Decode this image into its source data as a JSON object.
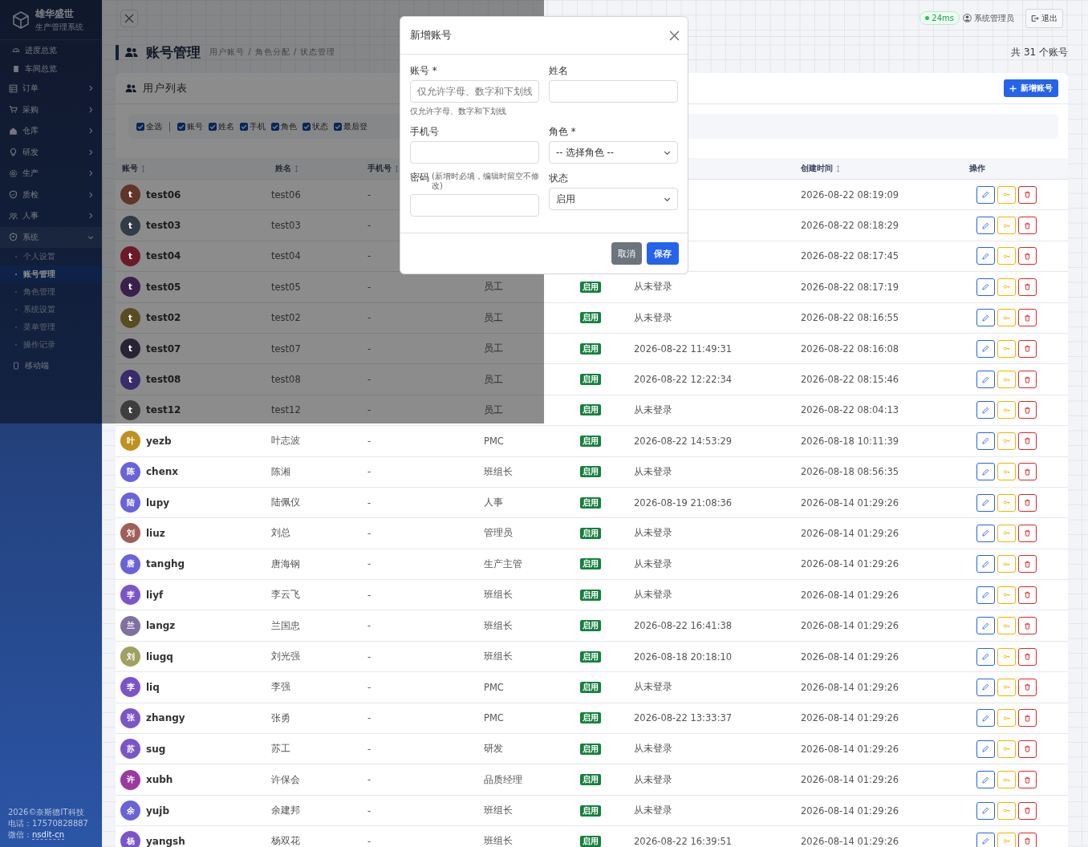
{
  "sidebar": {
    "brand": {
      "title": "雄华盛世",
      "subtitle": "生产管理系统"
    },
    "items": [
      {
        "label": "进度总览",
        "kind": "link",
        "selected": false
      },
      {
        "label": "车间总览",
        "kind": "link",
        "selected": false
      },
      {
        "label": "订单",
        "kind": "group",
        "expanded": false
      },
      {
        "label": "采购",
        "kind": "group",
        "expanded": false
      },
      {
        "label": "仓库",
        "kind": "group",
        "expanded": false
      },
      {
        "label": "研发",
        "kind": "group",
        "expanded": false
      },
      {
        "label": "生产",
        "kind": "group",
        "expanded": false
      },
      {
        "label": "质检",
        "kind": "group",
        "expanded": false
      },
      {
        "label": "人事",
        "kind": "group",
        "expanded": false
      },
      {
        "label": "系统",
        "kind": "group",
        "expanded": true,
        "children": [
          {
            "label": "个人设置",
            "selected": false
          },
          {
            "label": "账号管理",
            "selected": true
          },
          {
            "label": "角色管理",
            "selected": false
          },
          {
            "label": "系统设置",
            "selected": false
          },
          {
            "label": "菜单管理",
            "selected": false
          },
          {
            "label": "操作记录",
            "selected": false
          }
        ]
      },
      {
        "label": "移动端",
        "kind": "link",
        "selected": false
      }
    ],
    "footer": {
      "copyright": "2026©奈斯德IT科技",
      "phone": "电话：17570828887",
      "wechat_label": "微信：",
      "wechat": "nsdit-cn"
    }
  },
  "header": {
    "ping": "24ms",
    "user": "系统管理员",
    "logout": "退出"
  },
  "page": {
    "title": "账号管理",
    "subtitle": "用户账号 / 角色分配 / 状态管理",
    "count": "共 31 个账号"
  },
  "card": {
    "title": "用户列表",
    "add_button": "新增账号",
    "filters": [
      {
        "label": "全选",
        "checked": true,
        "kind": "all"
      },
      {
        "label": "账号",
        "checked": true,
        "kind": "column"
      },
      {
        "label": "姓名",
        "checked": true,
        "kind": "column"
      },
      {
        "label": "手机",
        "checked": true,
        "kind": "column"
      },
      {
        "label": "角色",
        "checked": true,
        "kind": "column"
      },
      {
        "label": "状态",
        "checked": true,
        "kind": "column"
      },
      {
        "label": "最后登",
        "checked": true,
        "kind": "column"
      }
    ]
  },
  "table": {
    "columns": [
      {
        "kind": "account",
        "label": "账号",
        "sortable": true
      },
      {
        "kind": "name",
        "label": "姓名",
        "sortable": true
      },
      {
        "kind": "phone",
        "label": "手机号",
        "sortable": true
      },
      {
        "kind": "created",
        "label": "创建时间",
        "sortable": true
      },
      {
        "kind": "actions",
        "label": "操作",
        "sortable": false
      }
    ],
    "rows": [
      {
        "initial": "t",
        "color": "#613529",
        "account": "test06",
        "name": "test06",
        "phone": "-",
        "created": "2026-08-22 08:19:09"
      },
      {
        "initial": "t",
        "color": "#323b46",
        "account": "test03",
        "name": "test03",
        "phone": "-",
        "created": "2026-08-22 08:18:29"
      },
      {
        "initial": "t",
        "color": "#6a1a29",
        "account": "test04",
        "name": "test04",
        "phone": "-",
        "created": "2026-08-22 08:17:45"
      },
      {
        "initial": "t",
        "color": "#3a204c",
        "account": "test05",
        "name": "test05",
        "phone": "-",
        "role": "员工",
        "status": "启用",
        "last_login": "从未登录",
        "created": "2026-08-22 08:17:19"
      },
      {
        "initial": "t",
        "color": "#584c23",
        "account": "test02",
        "name": "test02",
        "phone": "-",
        "role": "员工",
        "status": "启用",
        "last_login": "从未登录",
        "created": "2026-08-22 08:16:55"
      },
      {
        "initial": "t",
        "color": "#292335",
        "account": "test07",
        "name": "test07",
        "phone": "-",
        "role": "员工",
        "status": "启用",
        "last_login": "2026-08-22 11:49:31",
        "created": "2026-08-22 08:16:08"
      },
      {
        "initial": "t",
        "color": "#3a2c6a",
        "account": "test08",
        "name": "test08",
        "phone": "-",
        "role": "员工",
        "status": "启用",
        "last_login": "2026-08-22 12:22:34",
        "created": "2026-08-22 08:15:46"
      },
      {
        "initial": "t",
        "color": "#3e3e3e",
        "account": "test12",
        "name": "test12",
        "phone": "-",
        "role": "员工",
        "status": "启用",
        "last_login": "从未登录",
        "created": "2026-08-22 08:04:13"
      },
      {
        "initial": "叶",
        "color": "#c09020",
        "account": "yezb",
        "name": "叶志波",
        "phone": "-",
        "role": "PMC",
        "status": "启用",
        "last_login": "2026-08-22 14:53:29",
        "created": "2026-08-18 10:11:39"
      },
      {
        "initial": "陈",
        "color": "#6a62d8",
        "account": "chenx",
        "name": "陈湘",
        "phone": "-",
        "role": "班组长",
        "status": "启用",
        "last_login": "从未登录",
        "created": "2026-08-18 08:56:35"
      },
      {
        "initial": "陆",
        "color": "#6a62d8",
        "account": "lupy",
        "name": "陆佩仪",
        "phone": "-",
        "role": "人事",
        "status": "启用",
        "last_login": "2026-08-19 21:08:36",
        "created": "2026-08-14 01:29:26"
      },
      {
        "initial": "刘",
        "color": "#a0605a",
        "account": "liuz",
        "name": "刘总",
        "phone": "-",
        "role": "管理员",
        "status": "启用",
        "last_login": "从未登录",
        "created": "2026-08-14 01:29:26"
      },
      {
        "initial": "唐",
        "color": "#6a62d8",
        "account": "tanghg",
        "name": "唐海钢",
        "phone": "-",
        "role": "生产主管",
        "status": "启用",
        "last_login": "从未登录",
        "created": "2026-08-14 01:29:26"
      },
      {
        "initial": "李",
        "color": "#7a55c8",
        "account": "liyf",
        "name": "李云飞",
        "phone": "-",
        "role": "班组长",
        "status": "启用",
        "last_login": "从未登录",
        "created": "2026-08-14 01:29:26"
      },
      {
        "initial": "兰",
        "color": "#8070a0",
        "account": "langz",
        "name": "兰国忠",
        "phone": "-",
        "role": "班组长",
        "status": "启用",
        "last_login": "2026-08-22 16:41:38",
        "created": "2026-08-14 01:29:26"
      },
      {
        "initial": "刘",
        "color": "#a0a060",
        "account": "liugq",
        "name": "刘光强",
        "phone": "-",
        "role": "班组长",
        "status": "启用",
        "last_login": "2026-08-18 20:18:10",
        "created": "2026-08-14 01:29:26"
      },
      {
        "initial": "李",
        "color": "#7a55c8",
        "account": "liq",
        "name": "李强",
        "phone": "-",
        "role": "PMC",
        "status": "启用",
        "last_login": "从未登录",
        "created": "2026-08-14 01:29:26"
      },
      {
        "initial": "张",
        "color": "#7a55c8",
        "account": "zhangy",
        "name": "张勇",
        "phone": "-",
        "role": "PMC",
        "status": "启用",
        "last_login": "2026-08-22 13:33:37",
        "created": "2026-08-14 01:29:26"
      },
      {
        "initial": "苏",
        "color": "#7a55c8",
        "account": "sug",
        "name": "苏工",
        "phone": "-",
        "role": "研发",
        "status": "启用",
        "last_login": "从未登录",
        "created": "2026-08-14 01:29:26"
      },
      {
        "initial": "许",
        "color": "#9a3aa0",
        "account": "xubh",
        "name": "许保会",
        "phone": "-",
        "role": "品质经理",
        "status": "启用",
        "last_login": "从未登录",
        "created": "2026-08-14 01:29:26"
      },
      {
        "initial": "余",
        "color": "#6a62d8",
        "account": "yujb",
        "name": "余建邦",
        "phone": "-",
        "role": "班组长",
        "status": "启用",
        "last_login": "从未登录",
        "created": "2026-08-14 01:29:26"
      },
      {
        "initial": "杨",
        "color": "#7a55c8",
        "account": "yangsh",
        "name": "杨双花",
        "phone": "-",
        "role": "班组长",
        "status": "启用",
        "last_login": "2026-08-22 16:39:51",
        "created": "2026-08-14 01:29:26"
      }
    ]
  },
  "modal": {
    "title": "新增账号",
    "fields": [
      {
        "kind": "text",
        "label": "账号 *",
        "placeholder": "仅允许字母、数字和下划线",
        "help": "仅允许字母、数字和下划线"
      },
      {
        "kind": "text",
        "label": "姓名"
      },
      {
        "kind": "text",
        "label": "手机号"
      },
      {
        "kind": "select",
        "label": "角色 *",
        "value": "-- 选择角色 --"
      },
      {
        "kind": "password",
        "label": "密码",
        "hint": "(新增时必填，编辑时留空不修改)"
      },
      {
        "kind": "select",
        "label": "状态",
        "value": "启用"
      }
    ],
    "cancel": "取消",
    "save": "保存"
  }
}
